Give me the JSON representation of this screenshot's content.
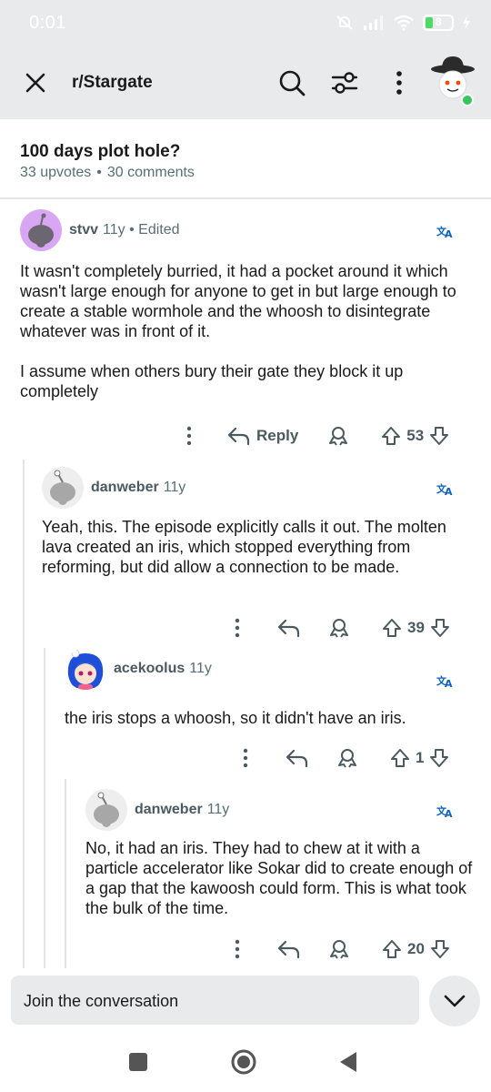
{
  "status": {
    "time": "0:01",
    "battery": "8"
  },
  "header": {
    "subreddit": "r/Stargate",
    "close_icon": "close-icon",
    "search_icon": "search-icon",
    "filter_icon": "filter-icon",
    "more_icon": "more-vertical-icon"
  },
  "post": {
    "title": "100 days plot hole?",
    "upvotes": "33 upvotes",
    "separator": "•",
    "comments": "30 comments"
  },
  "comments": [
    {
      "user": "stvv",
      "age": "11y",
      "edited": "• Edited",
      "body": [
        "It wasn't completely burried, it had a pocket around it which wasn't large enough for anyone to get in but large enough to create a stable wormhole and the whoosh to disintegrate whatever was in front of it.",
        "I assume when others bury their gate they block it up completely"
      ],
      "reply_label": "Reply",
      "votes": "53"
    },
    {
      "user": "danweber",
      "age": "11y",
      "body": [
        "Yeah, this. The episode explicitly calls it out. The molten lava created an iris, which stopped everything from reforming, but did allow a connection to be made."
      ],
      "votes": "39"
    },
    {
      "user": "acekoolus",
      "age": "11y",
      "body": [
        "the iris stops a whoosh, so it didn't have an iris."
      ],
      "votes": "1"
    },
    {
      "user": "danweber",
      "age": "11y",
      "body": [
        "No, it had an iris. They had to chew at it with a particle accelerator like Sokar did to create enough of a gap that the kawoosh could form. This is what took the bulk of the time."
      ],
      "votes": "20"
    }
  ],
  "composer": {
    "placeholder": "Join the conversation"
  },
  "colors": {
    "accent": "#0a62bd",
    "bar_bg": "#e9eaec",
    "meta": "#576f76"
  }
}
